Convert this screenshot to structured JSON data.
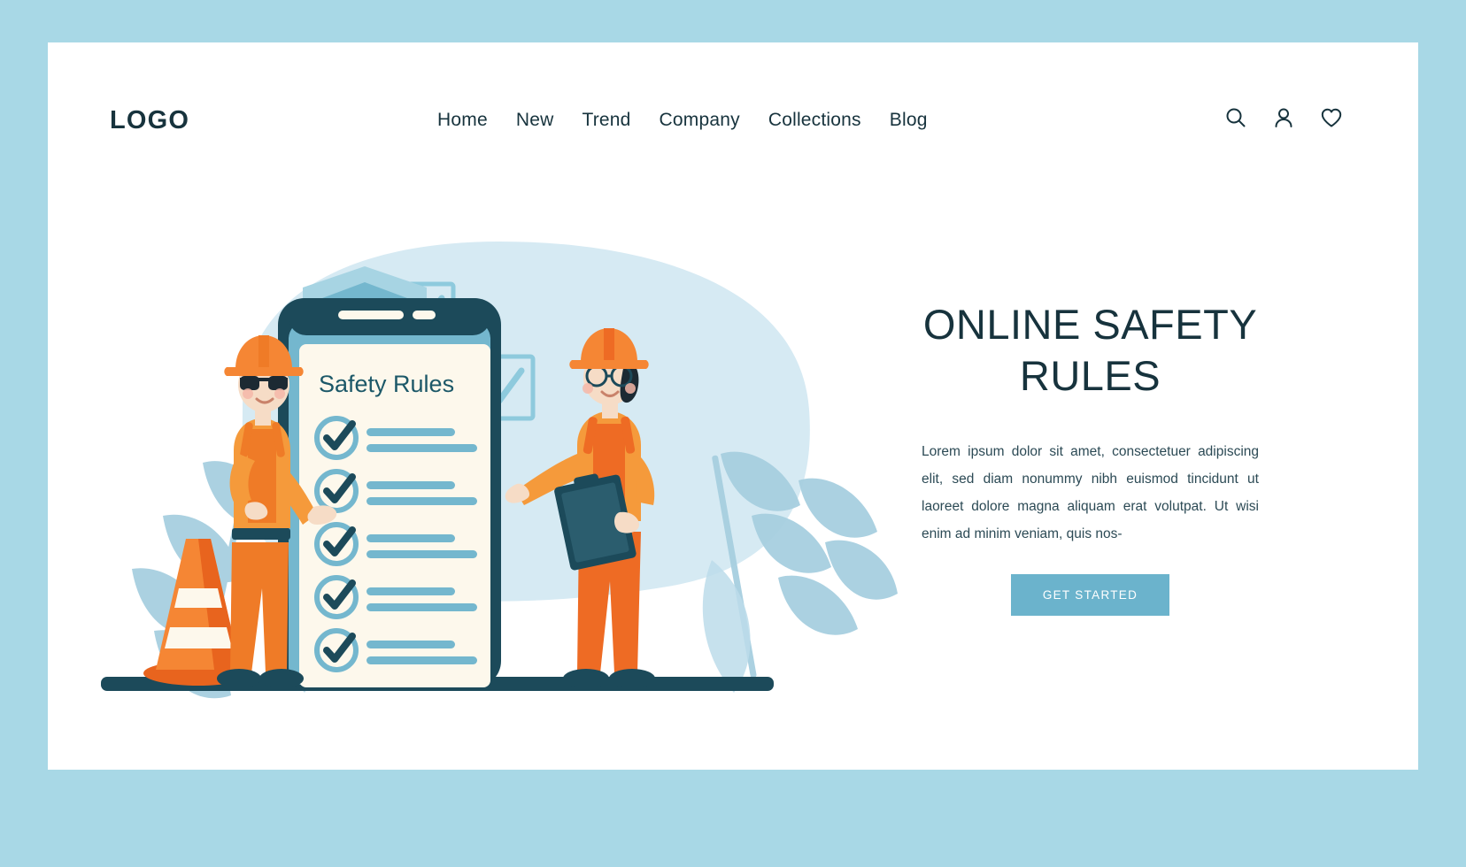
{
  "page": {
    "frame_color": "#a8d8e6",
    "card_color": "#ffffff",
    "text_dark": "#17333d",
    "accent_blue": "#6bb3cc",
    "accent_orange": "#f07e26"
  },
  "header": {
    "logo": "LOGO",
    "nav": [
      {
        "label": "Home"
      },
      {
        "label": "New"
      },
      {
        "label": "Trend"
      },
      {
        "label": "Company"
      },
      {
        "label": "Collections"
      },
      {
        "label": "Blog"
      }
    ],
    "icons": [
      {
        "name": "search-icon"
      },
      {
        "name": "user-icon"
      },
      {
        "name": "heart-icon"
      }
    ]
  },
  "hero": {
    "headline": "ONLINE SAFETY RULES",
    "paragraph": "Lorem ipsum dolor sit amet, consectetuer adipiscing elit, sed diam nonummy nibh euismod tincidunt ut laoreet dolore magna aliquam erat volutpat. Ut wisi enim ad minim veniam, quis nos-",
    "cta_label": "GET STARTED"
  },
  "illustration": {
    "phone_screen_title": "Safety Rules",
    "checklist_item_count": 5,
    "floating_checkbox_count": 3,
    "shield_icon": "shield-check-icon",
    "first_aid_icon": "first-aid-kit-icon",
    "traffic_cone_icon": "traffic-cone-icon",
    "workers": [
      {
        "name": "worker-left",
        "helmet_color": "#f07e26"
      },
      {
        "name": "worker-right",
        "helmet_color": "#f07e26"
      }
    ],
    "colors": {
      "blob": "#cfe7f0",
      "leaf": "#a7cfe0",
      "phone_body": "#1c4a5a",
      "phone_inner": "#6bb3cc",
      "screen": "#fdf8ec",
      "ground": "#1c4a5a",
      "shield_light": "#a7d4e3",
      "shield_mid": "#6bb3cc"
    }
  }
}
